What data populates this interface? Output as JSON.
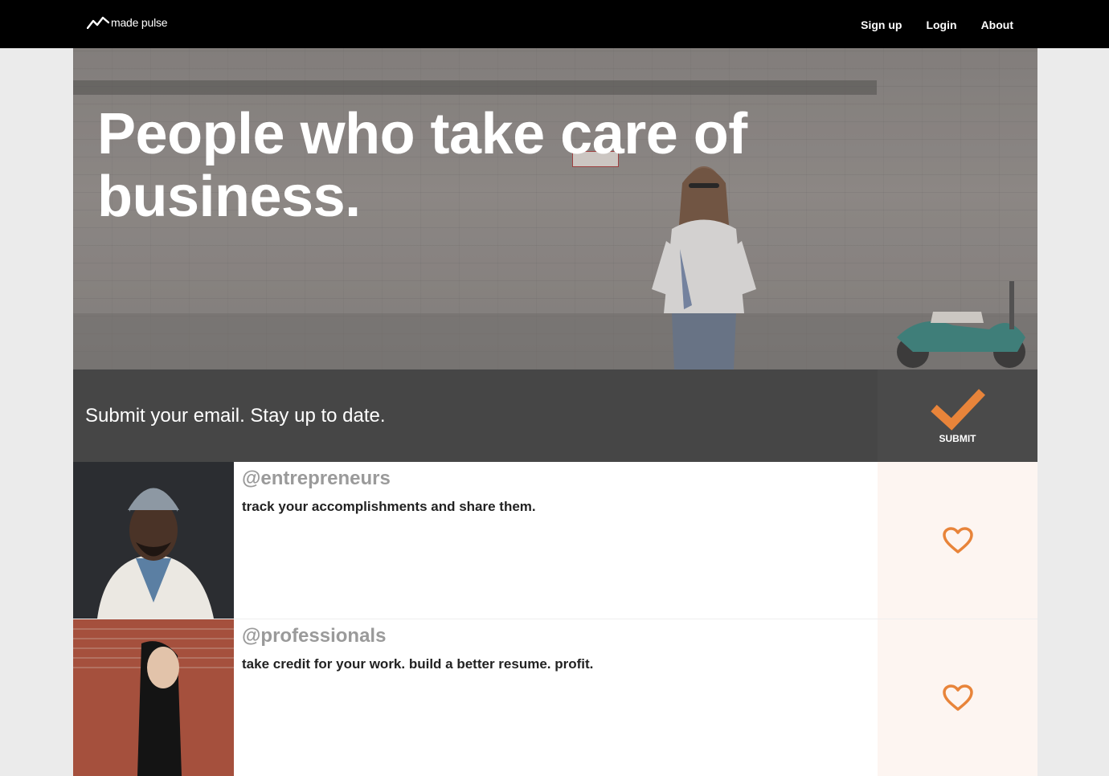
{
  "brand": {
    "name": "made pulse"
  },
  "nav": {
    "links": [
      "Sign up",
      "Login",
      "About"
    ]
  },
  "hero": {
    "headline_line1": "People who take care of",
    "headline_line2": "business."
  },
  "subscribe": {
    "prompt": "Submit your email. Stay up to date.",
    "submit_label": "SUBMIT"
  },
  "cards": [
    {
      "handle": "@entrepreneurs",
      "description": "track your accomplishments and share them."
    },
    {
      "handle": "@professionals",
      "description": "take credit for your work. build a better resume. profit."
    }
  ],
  "colors": {
    "accent": "#e8843a",
    "nav_bg": "#000000",
    "band_bg": "#464646",
    "like_bg": "#fdf5f1"
  },
  "icons": {
    "submit": "checkmark-icon",
    "like": "heart-icon",
    "logo": "pulse-line-icon"
  }
}
